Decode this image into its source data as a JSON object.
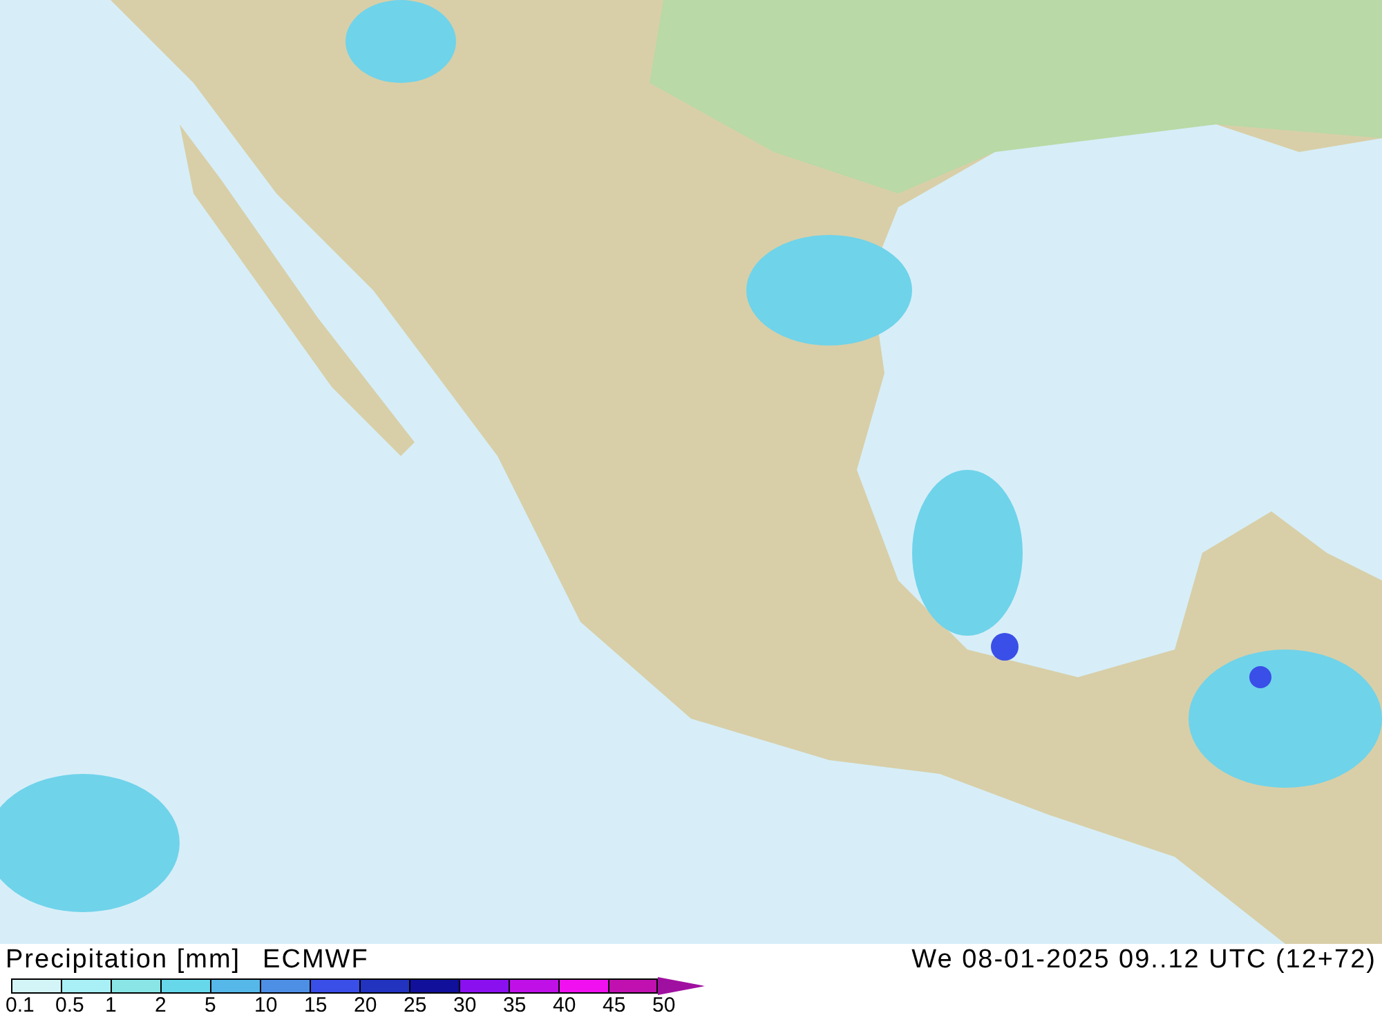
{
  "map": {
    "kind": "precipitation-map"
  },
  "footer": {
    "title": "Precipitation [mm]",
    "model": "ECMWF",
    "valid_time": "We 08-01-2025 09..12 UTC (12+72)"
  },
  "legend": {
    "swatches": [
      {
        "color": "#d4f5f7"
      },
      {
        "color": "#a8f0f5"
      },
      {
        "color": "#8ae6e6"
      },
      {
        "color": "#66d8ea"
      },
      {
        "color": "#55b8e8"
      },
      {
        "color": "#4e8fe6"
      },
      {
        "color": "#3a4ee8"
      },
      {
        "color": "#2233c0"
      },
      {
        "color": "#10109a"
      },
      {
        "color": "#8a10f0"
      },
      {
        "color": "#c010e8"
      },
      {
        "color": "#f010f0"
      },
      {
        "color": "#c010b0"
      },
      {
        "kind": "arrow",
        "color": "#a010a0"
      }
    ],
    "labels": [
      "0.1",
      "0.5",
      "1",
      "2",
      "5",
      "10",
      "15",
      "20",
      "25",
      "30",
      "35",
      "40",
      "45",
      "50"
    ]
  }
}
